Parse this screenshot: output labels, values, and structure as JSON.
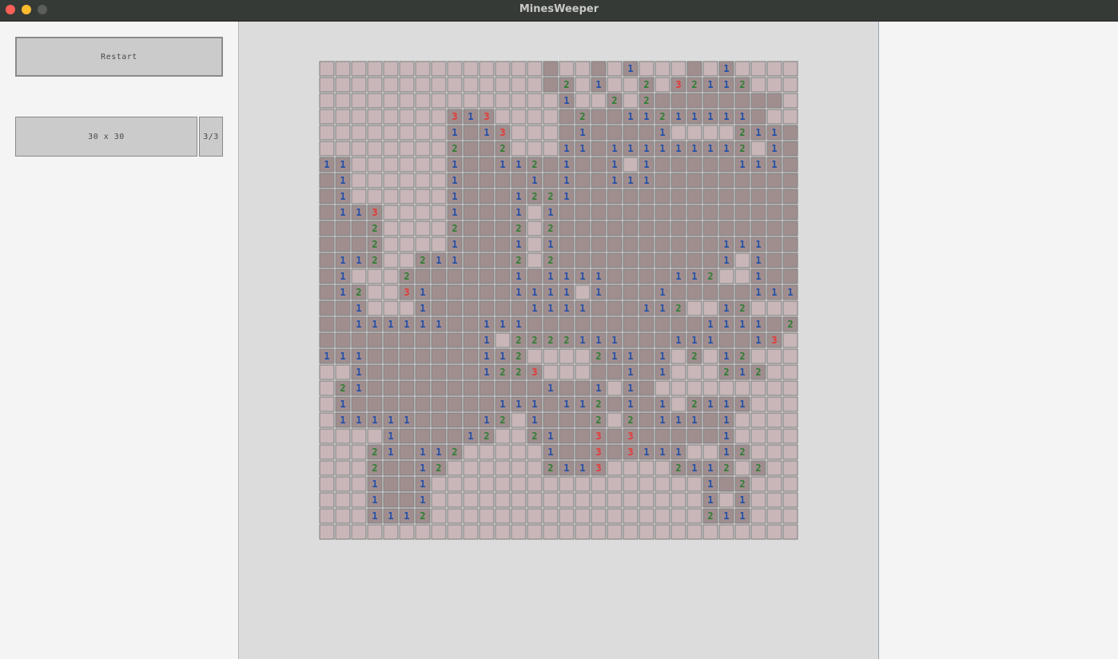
{
  "window": {
    "title": "MinesWeeper"
  },
  "controls": {
    "restart_label": "Restart",
    "size_label": "30 x 30",
    "level_label": "3/3"
  },
  "colors": {
    "hidden": "#c8b6b8",
    "revealed": "#a08e8f",
    "cell_border": "#7d7d7d",
    "num1": "#1f4fa8",
    "num2": "#2e7d32",
    "num3": "#e53935"
  },
  "board": {
    "rows": 30,
    "cols": 30,
    "cells": [
      "..............-..-.1...-.1....",
      "..............-2.1..2.32112...",
      "...............1..2.2--------.",
      "........313....-2--11211111-..",
      "........1-13...-1----1....211-",
      "........2--2...11-111111112.1-",
      "11......1--112-1--1.1-----111-",
      "-1......1----1-1--111---------",
      "-1......1---1221--------------",
      "-113....1---1.1---------------",
      "---2....2---2.2---------------",
      "---2....1---1.1----------111--",
      "-112..211---2.2----------1.1--",
      "-1...2------1-1111----112..1--",
      "-12..31-----1111.1---1-----1111",
      "--1...1------1111---112..12...",
      "--111111--111-----------1111-2..",
      "----------1.2222111---111--13..",
      "111-------112....211-1.2.12...",
      "..1-------1223...--1-1...212...",
      ".21-----------1--1.1-..........",
      ".1---------111-112-1-1.2111...",
      ".11111----12.1---2.2-111-1....",
      "....1----12..21--3-3-----1....",
      "...21-112.....1--3-3111..12...",
      "...2--12......2113....2112.2..",
      "...1--1.................1-2...",
      "...1--1.................1.1...",
      "...1112.................211...",
      ".............................."
    ]
  }
}
